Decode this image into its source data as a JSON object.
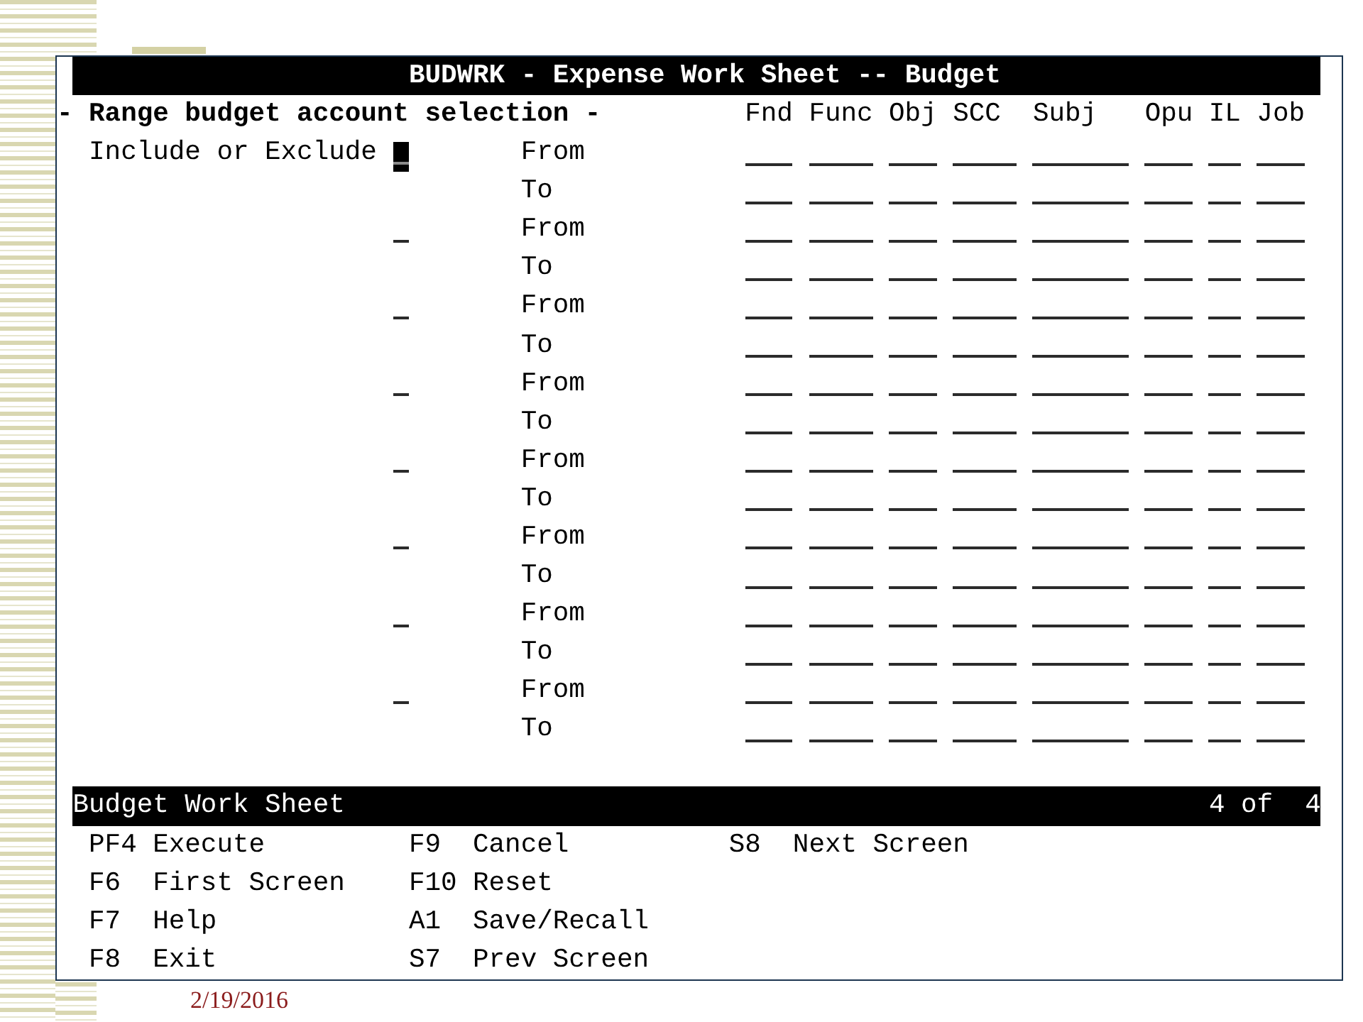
{
  "screen": {
    "title": "BUDWRK - Expense Work Sheet -- Budget"
  },
  "range_selection": {
    "heading": "- Range budget account selection -",
    "columns": [
      "Fnd",
      "Func",
      "Obj",
      "SCC",
      "Subj",
      "Opu",
      "IL",
      "Job"
    ],
    "ranges": [
      {
        "label": "Include or Exclude",
        "focused": true,
        "from_label": "From",
        "to_label": "To"
      },
      {
        "focused": false,
        "from_label": "From",
        "to_label": "To"
      },
      {
        "focused": false,
        "from_label": "From",
        "to_label": "To"
      },
      {
        "focused": false,
        "from_label": "From",
        "to_label": "To"
      },
      {
        "focused": false,
        "from_label": "From",
        "to_label": "To"
      },
      {
        "focused": false,
        "from_label": "From",
        "to_label": "To"
      },
      {
        "focused": false,
        "from_label": "From",
        "to_label": "To"
      },
      {
        "focused": false,
        "from_label": "From",
        "to_label": "To"
      }
    ]
  },
  "status_bar": {
    "title": "Budget Work Sheet",
    "page": "4 of  4"
  },
  "function_keys": [
    {
      "keys": [
        {
          "key": "PF4",
          "action": "Execute"
        },
        {
          "key": "F6",
          "action": "First Screen"
        },
        {
          "key": "F7",
          "action": "Help"
        },
        {
          "key": "F8",
          "action": "Exit"
        }
      ]
    },
    {
      "keys": [
        {
          "key": "F9",
          "action": "Cancel"
        },
        {
          "key": "F10",
          "action": "Reset"
        },
        {
          "key": "A1",
          "action": "Save/Recall"
        },
        {
          "key": "S7",
          "action": "Prev Screen"
        }
      ]
    },
    {
      "keys": [
        {
          "key": "S8",
          "action": "Next Screen"
        }
      ]
    }
  ],
  "date": "2/19/2016"
}
